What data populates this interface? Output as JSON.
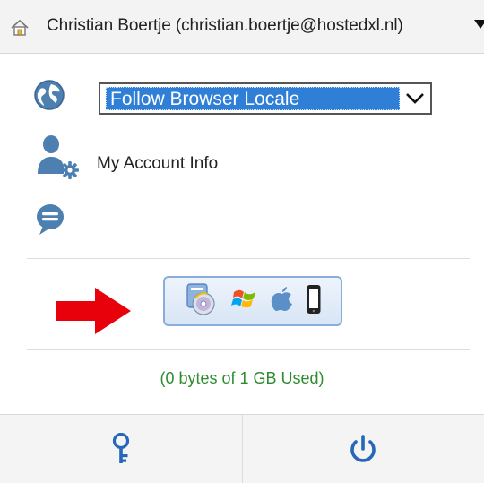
{
  "header": {
    "user_label": "Christian Boertje  (christian.boertje@hostedxl.nl)",
    "home_icon": "home-icon",
    "menu_icon": "caret-down-icon"
  },
  "locale": {
    "selected": "Follow Browser Locale",
    "icon": "globe-icon"
  },
  "account": {
    "label": "My Account Info",
    "icon": "user-settings-icon"
  },
  "chat": {
    "icon": "chat-bubble-icon"
  },
  "downloads": {
    "icons": [
      "client-cd-icon",
      "windows-icon",
      "apple-icon",
      "mobile-phone-icon"
    ]
  },
  "pointer": {
    "icon": "red-arrow-icon",
    "color": "#e8000b"
  },
  "storage": {
    "text": "(0 bytes of 1 GB Used)",
    "color": "#2e8b2e"
  },
  "footer": {
    "buttons": [
      {
        "icon": "key-icon",
        "color": "#2567b8"
      },
      {
        "icon": "power-icon",
        "color": "#2567b8"
      }
    ]
  },
  "colors": {
    "accent": "#2f7fd6",
    "header_bg": "#f3f3f3",
    "icon_blue": "#4d7fb0"
  }
}
